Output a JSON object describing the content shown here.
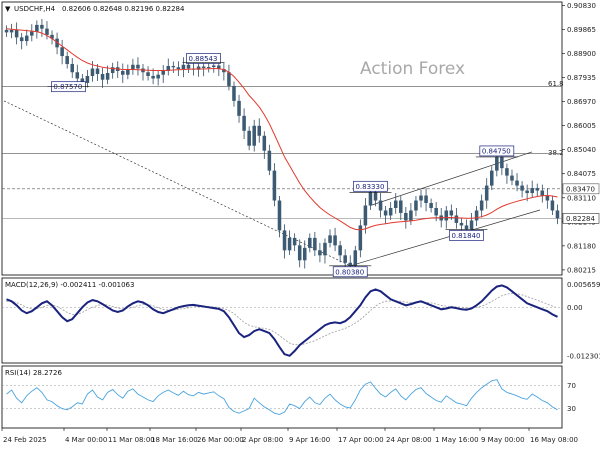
{
  "symbol": {
    "name": "USDCHF,H4",
    "ohlc": "0.82606 0.82648 0.82196 0.82284"
  },
  "watermark": "Action Forex",
  "fib_labels": {
    "f618": "61.8",
    "f382": "38.2"
  },
  "chart_data": [
    {
      "type": "candlestick",
      "title": "USDCHF,H4",
      "price_axis": [
        0.9083,
        0.89865,
        0.889,
        0.87935,
        0.8697,
        0.86005,
        0.8504,
        0.84075,
        0.8311,
        0.82145,
        0.8118,
        0.80215
      ],
      "price_axis_labels": [
        "0.90830",
        "0.89865",
        "0.88900",
        "0.87935",
        "0.86970",
        "0.86005",
        "0.85040",
        "0.84075",
        "0.83110",
        "0.82145",
        "0.81180",
        "0.80215"
      ],
      "ylim": [
        0.8005,
        0.9093
      ],
      "time_axis": [
        "24 Feb 2025",
        "4 Mar 00:00",
        "11 Mar 08:00",
        "18 Mar 16:00",
        "26 Mar 00:00",
        "2 Apr 08:00",
        "9 Apr 16:00",
        "17 Apr 00:00",
        "24 Apr 08:00",
        "1 May 16:00",
        "9 May 00:00",
        "16 May 08:00"
      ],
      "current_price": {
        "value": 0.82284,
        "label": "0.82284"
      },
      "horizontal_levels": [
        {
          "value": 0.8757,
          "style": "solid"
        },
        {
          "value": 0.8488,
          "style": "solid"
        },
        {
          "value": 0.8347,
          "style": "dashed",
          "label": "0.83470"
        }
      ],
      "annotations": [
        {
          "text": "0.88543",
          "value": 0.88543
        },
        {
          "text": "0.87570",
          "value": 0.8757
        },
        {
          "text": "0.83330",
          "value": 0.8333
        },
        {
          "text": "0.84750",
          "value": 0.8475
        },
        {
          "text": "0.81840",
          "value": 0.8184
        },
        {
          "text": "0.80380",
          "value": 0.8038
        }
      ],
      "close_series": [
        0.8975,
        0.8985,
        0.8955,
        0.894,
        0.8962,
        0.8978,
        0.9005,
        0.899,
        0.8965,
        0.895,
        0.8915,
        0.888,
        0.8848,
        0.8815,
        0.879,
        0.8772,
        0.88,
        0.883,
        0.8808,
        0.8785,
        0.8812,
        0.8835,
        0.882,
        0.8805,
        0.8828,
        0.8845,
        0.883,
        0.8815,
        0.88,
        0.879,
        0.8805,
        0.882,
        0.884,
        0.8835,
        0.8828,
        0.8845,
        0.883,
        0.8825,
        0.8838,
        0.8832,
        0.8836,
        0.8842,
        0.8828,
        0.8815,
        0.876,
        0.87,
        0.864,
        0.858,
        0.852,
        0.86,
        0.856,
        0.85,
        0.842,
        0.83,
        0.818,
        0.81,
        0.815,
        0.812,
        0.806,
        0.811,
        0.815,
        0.81,
        0.808,
        0.813,
        0.816,
        0.812,
        0.808,
        0.805,
        0.8038,
        0.81,
        0.82,
        0.828,
        0.8333,
        0.83,
        0.826,
        0.824,
        0.827,
        0.83,
        0.825,
        0.822,
        0.826,
        0.83,
        0.832,
        0.829,
        0.827,
        0.824,
        0.822,
        0.826,
        0.824,
        0.821,
        0.82,
        0.8184,
        0.822,
        0.826,
        0.83,
        0.836,
        0.842,
        0.8475,
        0.843,
        0.84,
        0.838,
        0.836,
        0.834,
        0.833,
        0.835,
        0.834,
        0.832,
        0.83,
        0.826,
        0.8228
      ],
      "ma_series": [
        0.899,
        0.8988,
        0.8986,
        0.8984,
        0.8982,
        0.898,
        0.8978,
        0.8972,
        0.8962,
        0.895,
        0.8935,
        0.892,
        0.8905,
        0.889,
        0.8875,
        0.8862,
        0.8852,
        0.8845,
        0.884,
        0.8835,
        0.8832,
        0.883,
        0.8828,
        0.8826,
        0.8826,
        0.8826,
        0.8825,
        0.8824,
        0.8823,
        0.8822,
        0.8822,
        0.8822,
        0.8823,
        0.8824,
        0.8825,
        0.8826,
        0.8827,
        0.8828,
        0.8828,
        0.8828,
        0.8829,
        0.883,
        0.8829,
        0.8826,
        0.8815,
        0.8798,
        0.8775,
        0.875,
        0.8722,
        0.87,
        0.8675,
        0.8645,
        0.8608,
        0.8565,
        0.852,
        0.8475,
        0.844,
        0.8405,
        0.837,
        0.834,
        0.8315,
        0.8292,
        0.8272,
        0.8256,
        0.8242,
        0.823,
        0.8218,
        0.8205,
        0.8192,
        0.8184,
        0.8182,
        0.8186,
        0.8194,
        0.82,
        0.8204,
        0.8207,
        0.821,
        0.8213,
        0.8215,
        0.8216,
        0.8218,
        0.8221,
        0.8225,
        0.8228,
        0.823,
        0.8231,
        0.8231,
        0.8232,
        0.8232,
        0.8231,
        0.823,
        0.8229,
        0.8229,
        0.8231,
        0.8235,
        0.8242,
        0.8252,
        0.8265,
        0.8276,
        0.8284,
        0.8291,
        0.8297,
        0.8302,
        0.8307,
        0.8312,
        0.8316,
        0.8319,
        0.832,
        0.8318,
        0.8314
      ]
    },
    {
      "type": "line",
      "title": "MACD(12,26,9) -0.002411 -0.001063",
      "yaxis_labels": [
        "0.005659",
        "0.00",
        "-0.012301"
      ],
      "ylim": [
        -0.0135,
        0.0066
      ],
      "zero_line": 0,
      "macd_series": [
        0.002,
        0.0015,
        0.0005,
        -0.0008,
        -0.0015,
        -0.001,
        0.0,
        0.001,
        0.0015,
        0.0005,
        -0.001,
        -0.0025,
        -0.0035,
        -0.003,
        -0.0015,
        0.0,
        0.0012,
        0.0018,
        0.0015,
        0.0008,
        0.0,
        -0.0008,
        -0.0012,
        -0.0008,
        0.0002,
        0.001,
        0.0015,
        0.0012,
        0.0005,
        -0.0005,
        -0.0012,
        -0.0015,
        -0.001,
        -0.0005,
        0.0,
        0.0003,
        0.0005,
        0.0006,
        0.0004,
        0.0002,
        0.0,
        -0.0002,
        -0.0004,
        -0.001,
        -0.0025,
        -0.0045,
        -0.0065,
        -0.0075,
        -0.007,
        -0.006,
        -0.0055,
        -0.006,
        -0.0065,
        -0.008,
        -0.01,
        -0.0118,
        -0.0122,
        -0.011,
        -0.0095,
        -0.0085,
        -0.0075,
        -0.0065,
        -0.0055,
        -0.0045,
        -0.004,
        -0.0038,
        -0.004,
        -0.0035,
        -0.0025,
        -0.001,
        0.0005,
        0.0025,
        0.004,
        0.0045,
        0.004,
        0.003,
        0.002,
        0.0015,
        0.001,
        0.0005,
        0.0008,
        0.0012,
        0.0015,
        0.001,
        0.0005,
        0.0,
        -0.0005,
        -0.0003,
        0.0,
        -0.0002,
        -0.0005,
        -0.0006,
        -0.0003,
        0.0005,
        0.0015,
        0.0028,
        0.0042,
        0.0052,
        0.0055,
        0.005,
        0.004,
        0.003,
        0.002,
        0.001,
        0.0005,
        0.0,
        -0.0005,
        -0.001,
        -0.0018,
        -0.0024
      ],
      "signal_series": [
        0.0015,
        0.0015,
        0.0012,
        0.0006,
        0.0,
        -0.0004,
        -0.0004,
        0.0,
        0.0005,
        0.0006,
        0.0002,
        -0.0005,
        -0.0013,
        -0.0018,
        -0.0018,
        -0.0013,
        -0.0006,
        0.0,
        0.0005,
        0.0007,
        0.0006,
        0.0002,
        -0.0002,
        -0.0004,
        -0.0003,
        0.0,
        0.0004,
        0.0007,
        0.0007,
        0.0004,
        -0.0001,
        -0.0005,
        -0.0007,
        -0.0007,
        -0.0005,
        -0.0003,
        -0.0001,
        0.0001,
        0.0002,
        0.0002,
        0.0002,
        0.0001,
        0.0,
        -0.0003,
        -0.0008,
        -0.0016,
        -0.0027,
        -0.0038,
        -0.0045,
        -0.0049,
        -0.0051,
        -0.0053,
        -0.0056,
        -0.0062,
        -0.0071,
        -0.0081,
        -0.009,
        -0.0094,
        -0.0094,
        -0.0092,
        -0.0088,
        -0.0084,
        -0.0078,
        -0.0072,
        -0.0066,
        -0.0061,
        -0.0057,
        -0.0053,
        -0.0047,
        -0.004,
        -0.0031,
        -0.002,
        -0.0008,
        0.0003,
        0.0011,
        0.0015,
        0.0016,
        0.0016,
        0.0015,
        0.0013,
        0.0012,
        0.0012,
        0.0013,
        0.0012,
        0.0011,
        0.0008,
        0.0005,
        0.0003,
        0.0002,
        0.0001,
        0.0,
        -0.0002,
        -0.0002,
        0.0,
        0.0003,
        0.0008,
        0.0015,
        0.0022,
        0.0029,
        0.0033,
        0.0035,
        0.0034,
        0.0031,
        0.0027,
        0.0022,
        0.0018,
        0.0013,
        0.0008,
        0.0003,
        -0.0002
      ]
    },
    {
      "type": "line",
      "title": "RSI(14) 28.2726",
      "yaxis_labels": [
        "70",
        "30"
      ],
      "ylim": [
        0,
        100
      ],
      "levels": [
        70,
        30
      ],
      "rsi_series": [
        55,
        62,
        48,
        40,
        52,
        60,
        66,
        58,
        45,
        42,
        35,
        30,
        28,
        33,
        40,
        38,
        55,
        62,
        50,
        45,
        58,
        63,
        54,
        48,
        60,
        64,
        55,
        50,
        45,
        42,
        52,
        58,
        62,
        57,
        53,
        60,
        54,
        52,
        58,
        55,
        57,
        59,
        52,
        47,
        32,
        25,
        22,
        26,
        30,
        48,
        40,
        33,
        28,
        22,
        20,
        24,
        38,
        35,
        30,
        42,
        50,
        40,
        37,
        48,
        55,
        45,
        38,
        33,
        31,
        45,
        62,
        72,
        76,
        65,
        55,
        50,
        58,
        64,
        52,
        45,
        55,
        63,
        66,
        56,
        50,
        44,
        41,
        52,
        46,
        40,
        38,
        35,
        48,
        58,
        66,
        72,
        78,
        80,
        64,
        58,
        55,
        52,
        48,
        46,
        55,
        50,
        44,
        40,
        33,
        28
      ]
    }
  ]
}
